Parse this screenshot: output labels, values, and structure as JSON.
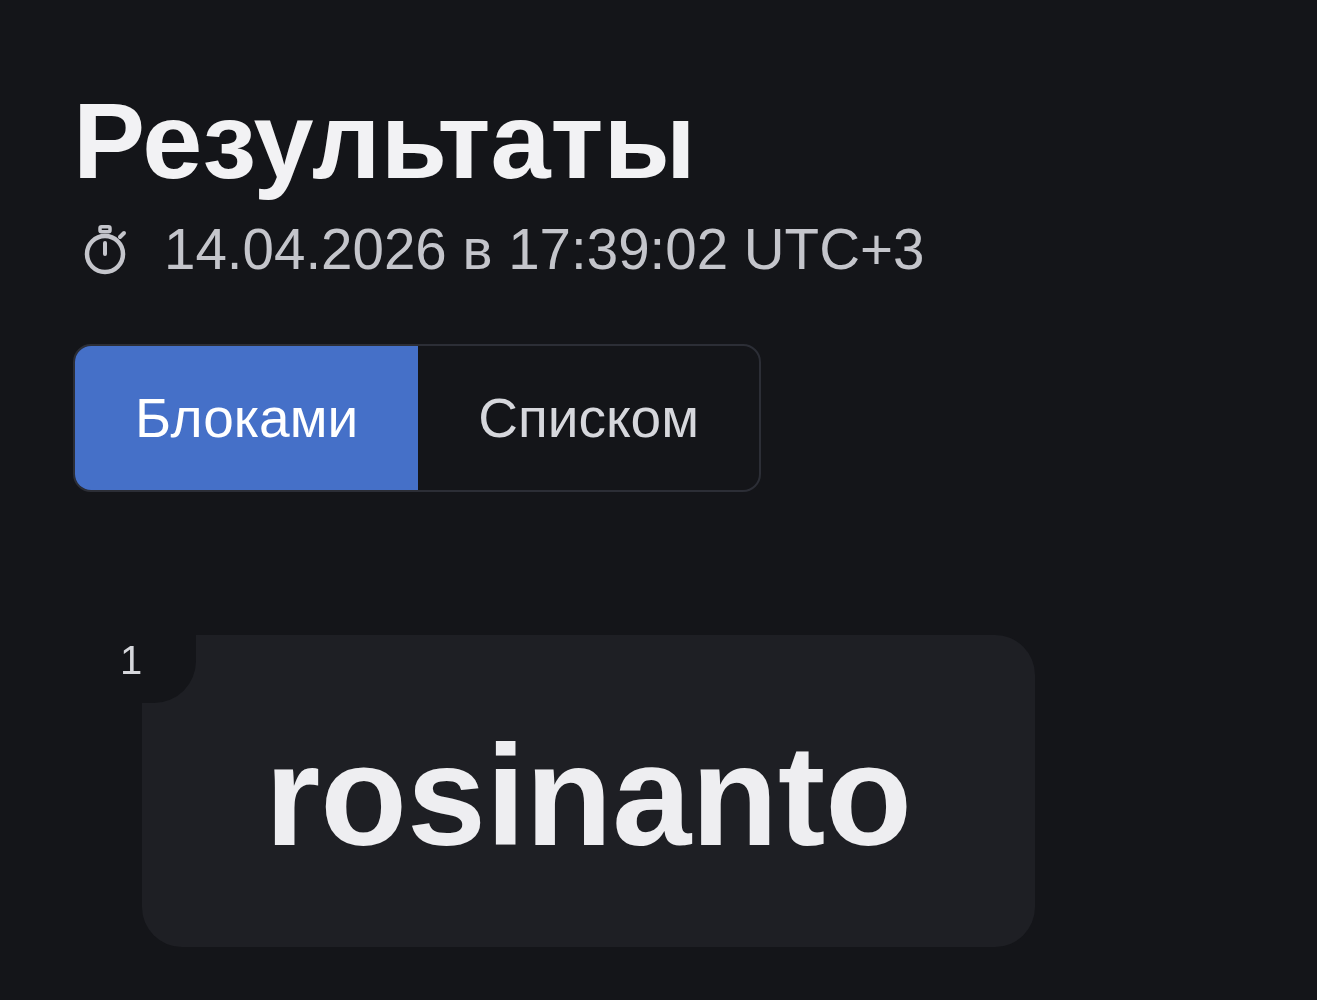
{
  "title": "Результаты",
  "timestamp": "14.04.2026 в 17:39:02 UTC+3",
  "view_modes": [
    {
      "label": "Блоками",
      "selected": true
    },
    {
      "label": "Списком",
      "selected": false
    }
  ],
  "results": [
    {
      "number": "1",
      "word": "rosinanto"
    }
  ]
}
